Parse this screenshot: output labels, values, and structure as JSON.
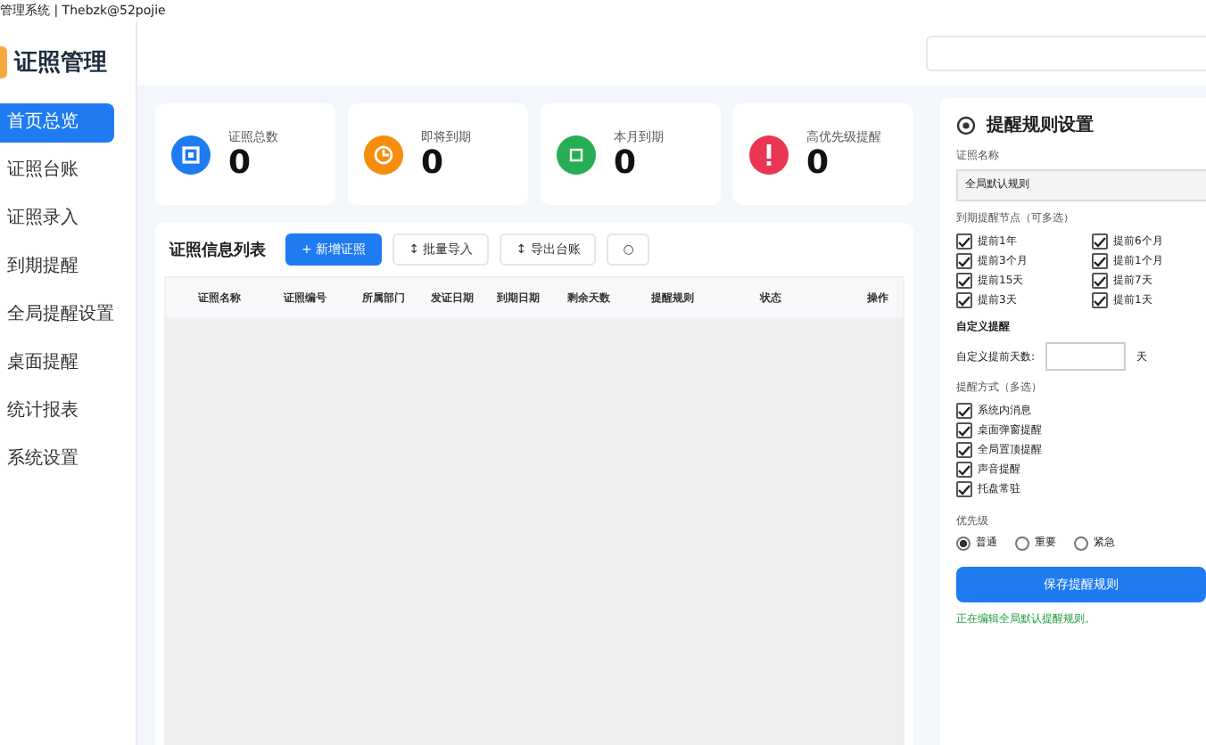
{
  "window": {
    "title": "管理系统 | Thebzk@52pojie"
  },
  "sidebar": {
    "logo": "证照管理",
    "items": [
      {
        "label": "首页总览",
        "selected": true
      },
      {
        "label": "证照台账",
        "selected": false
      },
      {
        "label": "证照录入",
        "selected": false
      },
      {
        "label": "到期提醒",
        "selected": false
      },
      {
        "label": "全局提醒设置",
        "selected": false
      },
      {
        "label": "桌面提醒",
        "selected": false
      },
      {
        "label": "统计报表",
        "selected": false
      },
      {
        "label": "系统设置",
        "selected": false
      }
    ]
  },
  "stats": [
    {
      "label": "证照总数",
      "value": "0",
      "color": "#1e7bf2",
      "kind": "square"
    },
    {
      "label": "即将到期",
      "value": "0",
      "color": "#f78d0a",
      "kind": "clock"
    },
    {
      "label": "本月到期",
      "value": "0",
      "color": "#27ae55",
      "kind": "box"
    },
    {
      "label": "高优先级提醒",
      "value": "0",
      "color": "#ea3553",
      "kind": "alert"
    }
  ],
  "table": {
    "title": "证照信息列表",
    "buttons": [
      {
        "label": "+ 新增证照",
        "kind": "primary"
      },
      {
        "label": "↕ 批量导入",
        "kind": "plain"
      },
      {
        "label": "↕ 导出台账",
        "kind": "plain"
      },
      {
        "label": "○",
        "kind": "plain"
      }
    ],
    "columns": [
      "证照名称",
      "证照编号",
      "所属部门",
      "发证日期",
      "到期日期",
      "剩余天数",
      "提醒规则",
      "状态",
      "操作"
    ]
  },
  "rules": {
    "title": "提醒规则设置",
    "name_label": "证照名称",
    "name_value": "全局默认规则",
    "nodes_label": "到期提醒节点（可多选）",
    "nodes": [
      {
        "label": "提前1年",
        "checked": true
      },
      {
        "label": "提前6个月",
        "checked": true
      },
      {
        "label": "提前3个月",
        "checked": true
      },
      {
        "label": "提前1个月",
        "checked": true
      },
      {
        "label": "提前15天",
        "checked": true
      },
      {
        "label": "提前7天",
        "checked": true
      },
      {
        "label": "提前3天",
        "checked": true
      },
      {
        "label": "提前1天",
        "checked": true
      }
    ],
    "custom_title": "自定义提醒",
    "custom_label": "自定义提前天数:",
    "custom_unit": "天",
    "methods_label": "提醒方式（多选）",
    "methods": [
      {
        "label": "系统内消息",
        "checked": true
      },
      {
        "label": "桌面弹窗提醒",
        "checked": true
      },
      {
        "label": "全局置顶提醒",
        "checked": true
      },
      {
        "label": "声音提醒",
        "checked": true
      },
      {
        "label": "托盘常驻",
        "checked": true
      }
    ],
    "priority_label": "优先级",
    "priorities": [
      {
        "label": "普通",
        "selected": true
      },
      {
        "label": "重要",
        "selected": false
      },
      {
        "label": "紧急",
        "selected": false
      }
    ],
    "save": "保存提醒规则",
    "status": "正在编辑全局默认提醒规则。"
  }
}
